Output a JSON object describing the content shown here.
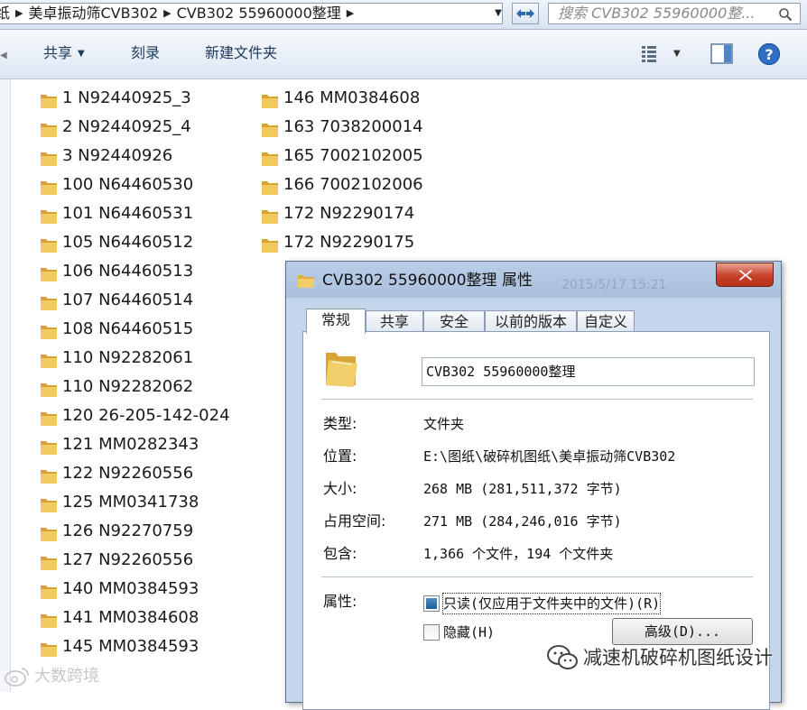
{
  "address_bar": {
    "crumbs": [
      "纸",
      "美卓振动筛CVB302",
      "CVB302 55960000整理"
    ],
    "search_placeholder": "搜索 CVB302 55960000整..."
  },
  "toolbar": {
    "share_label": "共享",
    "burn_label": "刻录",
    "new_folder_label": "新建文件夹"
  },
  "files": {
    "column1": [
      "1  N92440925_3",
      "2  N92440925_4",
      "3  N92440926",
      "100  N64460530",
      "101  N64460531",
      "105  N64460512",
      "106  N64460513",
      "107  N64460514",
      "108  N64460515",
      "110  N92282061",
      "110  N92282062",
      "120  26-205-142-024",
      "121  MM0282343",
      "122  N92260556",
      "125  MM0341738",
      "126  N92270759",
      "127  N92260556",
      "140  MM0384593",
      "141  MM0384608",
      "145  MM0384593"
    ],
    "column2": [
      "146  MM0384608",
      "163  7038200014",
      "165  7002102005",
      "166  7002102006",
      "172  N92290174",
      "172  N92290175"
    ]
  },
  "dialog": {
    "title": "CVB302 55960000整理 属性",
    "background_ghost_text": "2015/5/17 15:21",
    "tabs": [
      "常规",
      "共享",
      "安全",
      "以前的版本",
      "自定义"
    ],
    "active_tab": "常规",
    "folder_name": "CVB302 55960000整理",
    "properties": [
      {
        "label": "类型:",
        "value": "文件夹"
      },
      {
        "label": "位置:",
        "value": "E:\\图纸\\破碎机图纸\\美卓振动筛CVB302"
      },
      {
        "label": "大小:",
        "value": "268 MB (281,511,372 字节)"
      },
      {
        "label": "占用空间:",
        "value": "271 MB (284,246,016 字节)"
      },
      {
        "label": "包含:",
        "value": "1,366 个文件，194 个文件夹"
      }
    ],
    "attributes_label": "属性:",
    "readonly_label": "只读(仅应用于文件夹中的文件)(R)",
    "hidden_label": "隐藏(H)",
    "advanced_button": "高级(D)..."
  },
  "watermarks": {
    "right": "减速机破碎机图纸设计",
    "left": "大数跨境"
  },
  "colors": {
    "folder": "#e8b84a",
    "close_button": "#c7412a",
    "toolbar_text": "#1e395b"
  }
}
